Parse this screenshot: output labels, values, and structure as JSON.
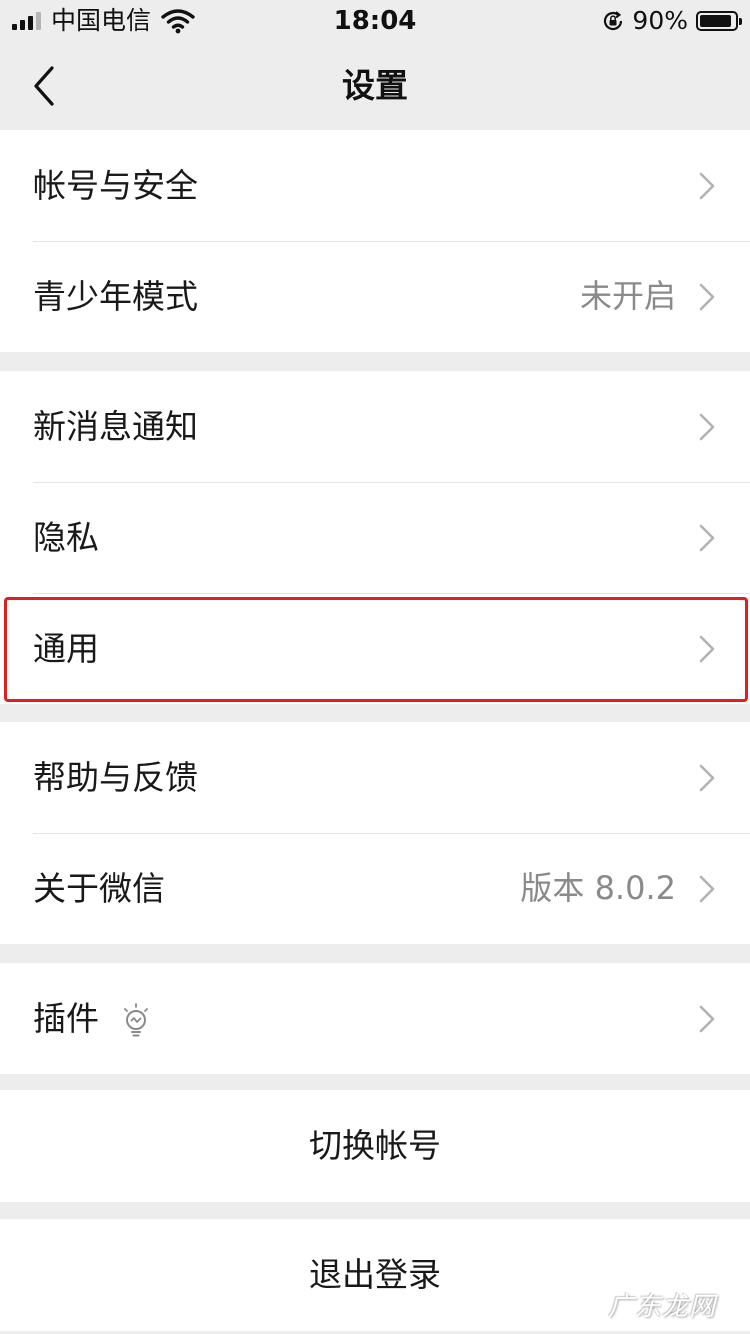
{
  "status_bar": {
    "carrier": "中国电信",
    "time": "18:04",
    "battery_percent": "90%",
    "battery_level": 0.9,
    "icons": [
      "signal-icon",
      "wifi-icon",
      "rotation-lock-icon",
      "battery-icon"
    ]
  },
  "nav": {
    "title": "设置",
    "back_icon": "chevron-left-icon"
  },
  "groups": {
    "account": {
      "security": {
        "label": "帐号与安全"
      },
      "youth": {
        "label": "青少年模式",
        "value": "未开启"
      }
    },
    "prefs": {
      "notify": {
        "label": "新消息通知"
      },
      "privacy": {
        "label": "隐私"
      },
      "general": {
        "label": "通用"
      }
    },
    "about": {
      "help": {
        "label": "帮助与反馈"
      },
      "about": {
        "label": "关于微信",
        "value": "版本 8.0.2"
      }
    },
    "plugins": {
      "plugin": {
        "label": "插件",
        "icon": "lightbulb-icon"
      }
    }
  },
  "actions": {
    "switch_account": "切换帐号",
    "logout": "退出登录"
  },
  "highlight": {
    "target": "通用",
    "color": "#e02020"
  },
  "watermark": "广东龙网",
  "colors": {
    "background": "#ededed",
    "cell": "#ffffff",
    "secondary_text": "#8a8a8a",
    "highlight": "#e02020"
  }
}
